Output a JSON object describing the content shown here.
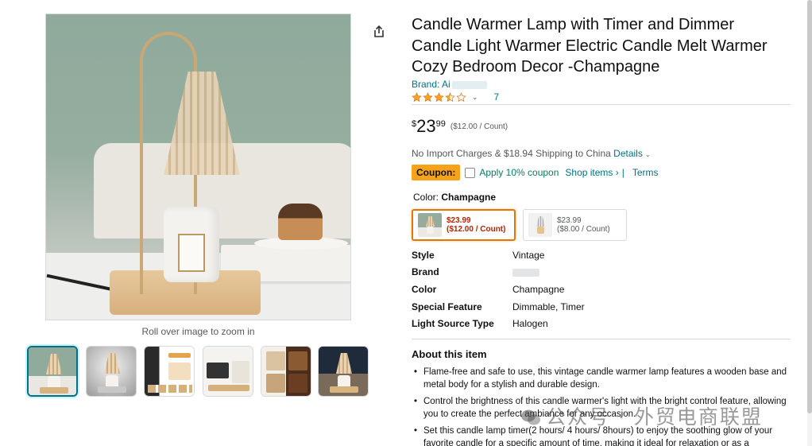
{
  "product": {
    "title": "Candle Warmer Lamp with Timer and Dimmer Candle Light Warmer Electric Candle Melt Warmer Cozy Bedroom Decor -Champagne",
    "brand_prefix": "Brand: Ai",
    "rating_stars": 3.5,
    "rating_count": "7",
    "price": {
      "symbol": "$",
      "whole": "23",
      "fraction": "99",
      "unit_price": "($12.00 / Count)"
    },
    "shipping_text": "No Import Charges & $18.94 Shipping to China",
    "shipping_link": "Details",
    "coupon": {
      "badge": "Coupon:",
      "apply_text": "Apply 10% coupon",
      "shop_items": "Shop items ›",
      "separator": "|",
      "terms": "Terms"
    },
    "color_label_prefix": "Color:",
    "color_selected": "Champagne",
    "swatches": [
      {
        "price": "$23.99",
        "unit": "($12.00 / Count)"
      },
      {
        "price": "$23.99",
        "unit": "($8.00 / Count)"
      }
    ],
    "specs": [
      {
        "key": "Style",
        "value": "Vintage"
      },
      {
        "key": "Brand",
        "value": ""
      },
      {
        "key": "Color",
        "value": "Champagne"
      },
      {
        "key": "Special Feature",
        "value": "Dimmable, Timer"
      },
      {
        "key": "Light Source Type",
        "value": "Halogen"
      }
    ],
    "about_title": "About this item",
    "about_items": [
      "Flame-free and safe to use, this vintage candle warmer lamp features a wooden base and metal body for a stylish and durable design.",
      "Control the brightness of this candle warmer's light with the bright control feature, allowing you to create the perfect ambiance for any occasion.",
      "Set this candle lamp timer(2 hours/ 4 hours/ 8hours) to enjoy the soothing glow of your favorite candle for a specific amount of time, making it ideal for relaxation or as a"
    ]
  },
  "gallery": {
    "zoom_hint": "Roll over image to zoom in",
    "thumbnail_count": 6,
    "active_thumbnail": 0
  },
  "watermark": "公众号 · 外贸电商联盟",
  "icons": {
    "share": "share-icon",
    "star": "star-icon",
    "chevron": "chevron-down-icon"
  },
  "colors": {
    "link": "#007185",
    "coupon_badge": "#F7A21B",
    "coupon_text": "#067D62",
    "price_red": "#B12704",
    "star": "#FFA41C",
    "selected_border": "#e77600"
  }
}
